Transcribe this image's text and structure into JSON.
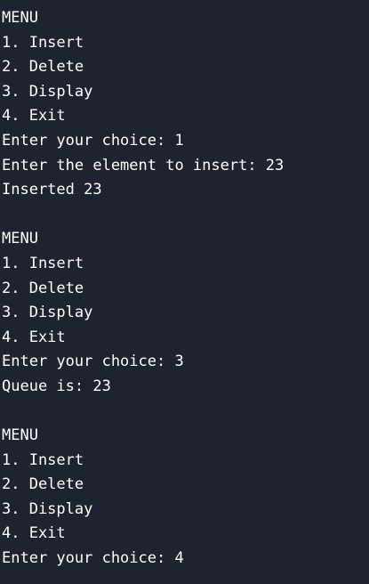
{
  "terminal": {
    "lines": [
      "MENU",
      "1. Insert",
      "2. Delete",
      "3. Display",
      "4. Exit",
      "Enter your choice: 1",
      "Enter the element to insert: 23",
      "Inserted 23",
      "",
      "MENU",
      "1. Insert",
      "2. Delete",
      "3. Display",
      "4. Exit",
      "Enter your choice: 3",
      "Queue is: 23",
      "",
      "MENU",
      "1. Insert",
      "2. Delete",
      "3. Display",
      "4. Exit",
      "Enter your choice: 4"
    ]
  },
  "colors": {
    "background": "#1e2330",
    "text": "#ffffff"
  }
}
